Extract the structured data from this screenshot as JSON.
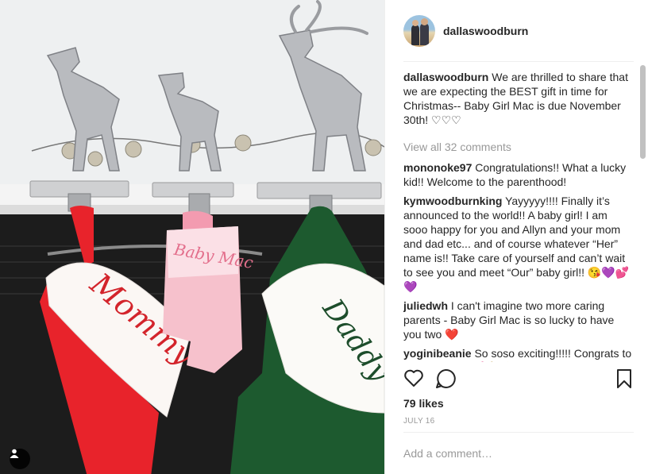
{
  "photo": {
    "stockings": [
      "Mommy",
      "Baby Mac",
      "Daddy"
    ],
    "user_tag_icon": "person-icon"
  },
  "post": {
    "username": "dallaswoodburn",
    "caption_user": "dallaswoodburn",
    "caption_text": " We are thrilled to share that we are expecting the BEST gift in time for Christmas-- Baby Girl Mac is due November 30th! ♡♡♡",
    "view_all": "View all 32 comments",
    "comments": [
      {
        "user": "mononoke97",
        "text": " Congratulations!! What a lucky kid!! Welcome to the parenthood!"
      },
      {
        "user": "kymwoodburnking",
        "text": " Yayyyyy!!!! Finally it’s announced to the world!! A baby girl! I am sooo happy for you and Allyn and your mom and dad etc... and of course whatever “Her” name is!! Take care of yourself and can’t wait to see you and meet “Our” baby girl!! 😘💜💕💜"
      },
      {
        "user": "juliedwh",
        "text": " I can't imagine two more caring parents - Baby Girl Mac is so lucky to have you two ❤️"
      },
      {
        "user": "yoginibeanie",
        "text": " So soso exciting!!!!! Congrats to you guys!! 💚💕👶🏼✨"
      }
    ],
    "likes": "79 likes",
    "date": "JULY 16",
    "add_comment_placeholder": "Add a comment…"
  }
}
